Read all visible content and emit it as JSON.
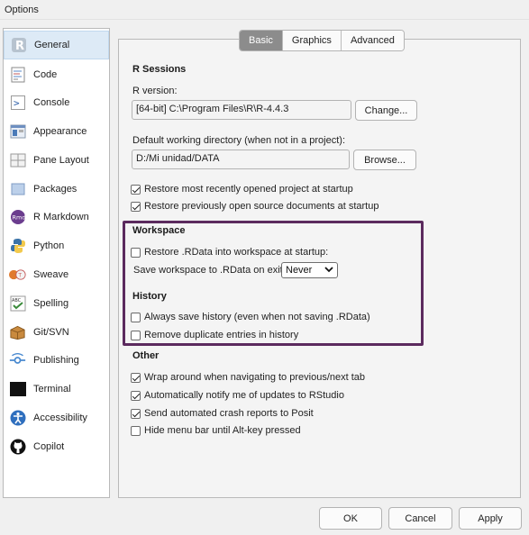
{
  "window": {
    "title": "Options"
  },
  "sidebar": {
    "items": [
      {
        "label": "General",
        "icon": "r-logo-icon"
      },
      {
        "label": "Code",
        "icon": "code-icon"
      },
      {
        "label": "Console",
        "icon": "console-icon"
      },
      {
        "label": "Appearance",
        "icon": "appearance-icon"
      },
      {
        "label": "Pane Layout",
        "icon": "pane-layout-icon"
      },
      {
        "label": "Packages",
        "icon": "packages-icon"
      },
      {
        "label": "R Markdown",
        "icon": "rmarkdown-icon"
      },
      {
        "label": "Python",
        "icon": "python-icon"
      },
      {
        "label": "Sweave",
        "icon": "sweave-icon"
      },
      {
        "label": "Spelling",
        "icon": "spelling-icon"
      },
      {
        "label": "Git/SVN",
        "icon": "git-icon"
      },
      {
        "label": "Publishing",
        "icon": "publishing-icon"
      },
      {
        "label": "Terminal",
        "icon": "terminal-icon"
      },
      {
        "label": "Accessibility",
        "icon": "accessibility-icon"
      },
      {
        "label": "Copilot",
        "icon": "github-icon"
      }
    ],
    "selected": "General"
  },
  "tabs": [
    {
      "label": "Basic",
      "active": true
    },
    {
      "label": "Graphics",
      "active": false
    },
    {
      "label": "Advanced",
      "active": false
    }
  ],
  "r_sessions": {
    "title": "R Sessions",
    "version_label": "R version:",
    "version_value": "[64-bit] C:\\Program Files\\R\\R-4.4.3",
    "change_button": "Change...",
    "wd_label": "Default working directory (when not in a project):",
    "wd_value": "D:/Mi unidad/DATA",
    "browse_button": "Browse...",
    "restore_project": {
      "label": "Restore most recently opened project at startup",
      "checked": true
    },
    "restore_docs": {
      "label": "Restore previously open source documents at startup",
      "checked": true
    }
  },
  "workspace": {
    "title": "Workspace",
    "restore_rdata": {
      "label": "Restore .RData into workspace at startup:",
      "checked": false
    },
    "save_label": "Save workspace to .RData on exit:",
    "save_value": "Never"
  },
  "history": {
    "title": "History",
    "always_save": {
      "label": "Always save history (even when not saving .RData)",
      "checked": false
    },
    "remove_dups": {
      "label": "Remove duplicate entries in history",
      "checked": false
    }
  },
  "other": {
    "title": "Other",
    "wrap": {
      "label": "Wrap around when navigating to previous/next tab",
      "checked": true
    },
    "notify": {
      "label": "Automatically notify me of updates to RStudio",
      "checked": true
    },
    "crash": {
      "label": "Send automated crash reports to Posit",
      "checked": true
    },
    "hide_menu": {
      "label": "Hide menu bar until Alt-key pressed",
      "checked": false
    }
  },
  "footer": {
    "ok": "OK",
    "cancel": "Cancel",
    "apply": "Apply"
  },
  "colors": {
    "highlight": "#5b2a5e",
    "selected_bg": "#ddeaf6",
    "active_tab": "#8c8c8c"
  }
}
